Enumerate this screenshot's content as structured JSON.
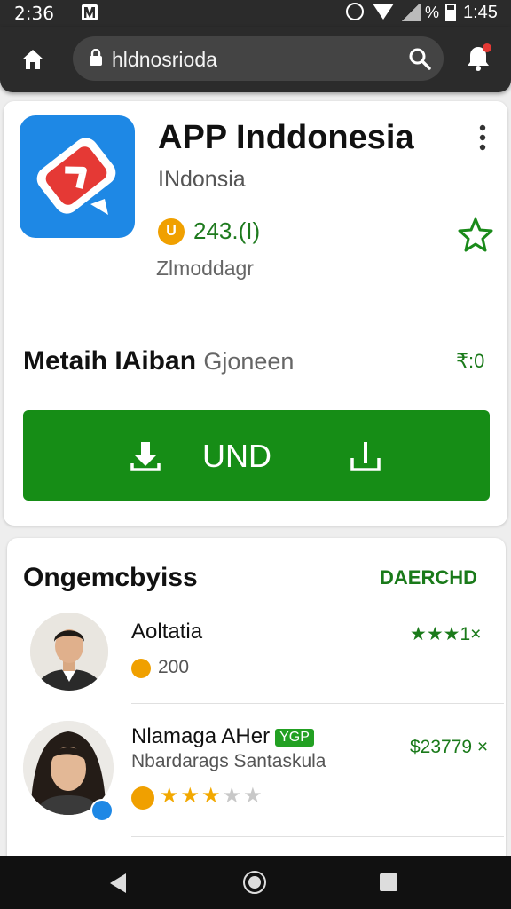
{
  "status_bar": {
    "time_left": "2:36",
    "battery_pct": "%",
    "time_right": "1:45"
  },
  "browser": {
    "url": "hldnosrioda"
  },
  "app": {
    "title": "APP Inddonesia",
    "subtitle": "INdonsia",
    "coin_symbol": "U",
    "rating": "243.(I)",
    "meta": "Zlmoddagr",
    "section_label_strong": "Metaih IAiban",
    "section_label_light": "Gjoneen",
    "section_count": "₹:0",
    "install_label": "UND"
  },
  "list": {
    "header": "Ongemcbyiss",
    "action": "DAERCHD",
    "items": [
      {
        "title": "Aoltatia",
        "sub": "200",
        "value": "★★★1×",
        "rating": 0
      },
      {
        "title": "Nlamaga AHer",
        "tag": "YGP",
        "sub": "Nbardarags Santaskula",
        "value": "$23779 ×",
        "rating": 3,
        "rating_max": 5
      }
    ]
  },
  "icons": {
    "home": "home-icon",
    "lock": "lock-icon",
    "search": "search-icon",
    "alert": "alert-icon",
    "more": "more-vert-icon",
    "favorite": "star-icon",
    "download": "download-icon"
  },
  "colors": {
    "accent_green": "#168d16",
    "brand_blue": "#1e88e5",
    "brand_red": "#e53935",
    "coin": "#f0a000"
  }
}
